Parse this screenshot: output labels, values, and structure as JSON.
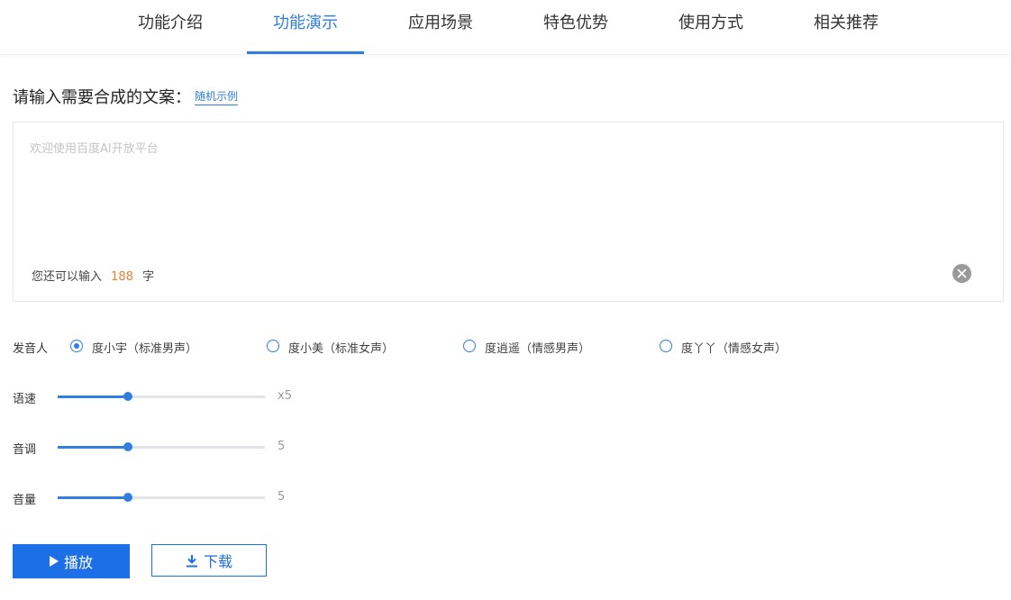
{
  "nav": {
    "tabs": [
      {
        "label": "功能介绍",
        "active": false
      },
      {
        "label": "功能演示",
        "active": true
      },
      {
        "label": "应用场景",
        "active": false
      },
      {
        "label": "特色优势",
        "active": false
      },
      {
        "label": "使用方式",
        "active": false
      },
      {
        "label": "相关推荐",
        "active": false
      }
    ]
  },
  "input_section": {
    "title": "请输入需要合成的文案：",
    "random_link": "随机示例",
    "placeholder": "欢迎使用百度AI开放平台",
    "value": "",
    "remaining_prefix": "您还可以输入",
    "remaining_count": "188",
    "remaining_suffix": "字",
    "clear_icon": "clear-circle-icon"
  },
  "voice": {
    "label": "发音人",
    "options": [
      {
        "label": "度小宇（标准男声）",
        "checked": true
      },
      {
        "label": "度小美（标准女声）",
        "checked": false
      },
      {
        "label": "度逍遥（情感男声）",
        "checked": false
      },
      {
        "label": "度丫丫（情感女声）",
        "checked": false
      }
    ]
  },
  "sliders": [
    {
      "label": "语速",
      "value_text": "x5",
      "level": 5,
      "max": 15
    },
    {
      "label": "音调",
      "value_text": "5",
      "level": 5,
      "max": 15
    },
    {
      "label": "音量",
      "value_text": "5",
      "level": 5,
      "max": 15
    }
  ],
  "actions": {
    "play_label": "播放",
    "play_icon": "play-triangle-icon",
    "download_label": "下载",
    "download_icon": "download-arrow-icon"
  },
  "colors": {
    "accent": "#2f7ee0",
    "button_blue": "#1c6fe6",
    "count_orange": "#f07c2e"
  }
}
